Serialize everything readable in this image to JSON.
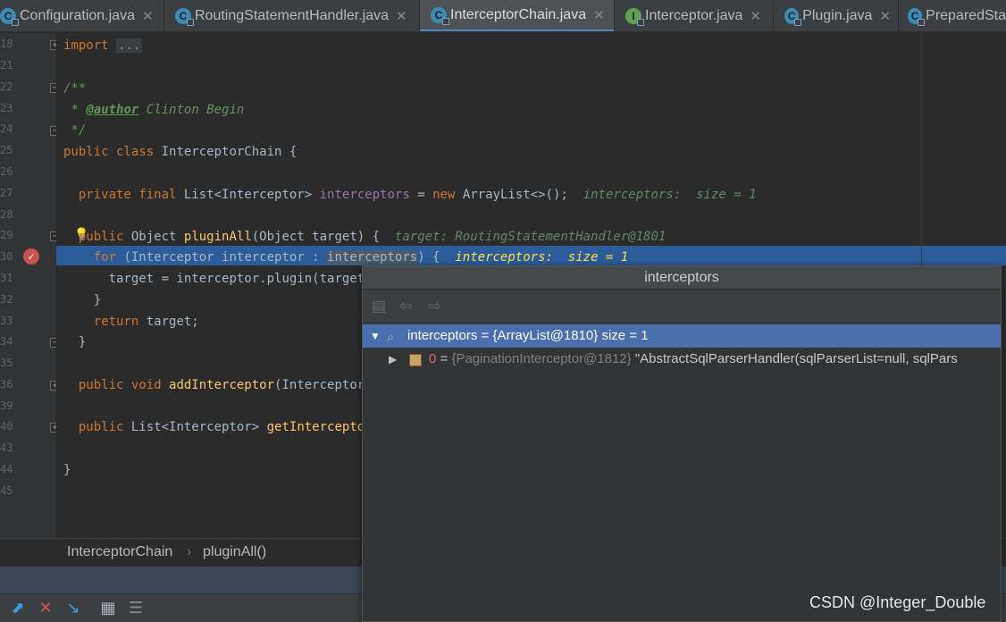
{
  "tabs": [
    {
      "label": "Configuration.java",
      "kind": "class",
      "active": false
    },
    {
      "label": "RoutingStatementHandler.java",
      "kind": "class",
      "active": false
    },
    {
      "label": "InterceptorChain.java",
      "kind": "class",
      "active": true
    },
    {
      "label": "Interceptor.java",
      "kind": "interface",
      "active": false
    },
    {
      "label": "Plugin.java",
      "kind": "class",
      "active": false
    },
    {
      "label": "PreparedSta",
      "kind": "class",
      "active": false
    }
  ],
  "gutter": {
    "line_numbers": [
      "18",
      "21",
      "22",
      "23",
      "24",
      "25",
      "26",
      "27",
      "28",
      "29",
      "30",
      "31",
      "32",
      "33",
      "34",
      "35",
      "36",
      "39",
      "40",
      "43",
      "44",
      "45"
    ],
    "breakpoint_icon": "breakpoint-check-icon"
  },
  "code": {
    "import_kw": "import",
    "import_dots": "...",
    "doc_open": "/**",
    "doc_star": "*",
    "author_tag": "@author",
    "author_name": "Clinton Begin",
    "doc_close": "*/",
    "class_decl_kw": "public class",
    "class_name": "InterceptorChain {",
    "field_mods": "private final",
    "field_type": "List<Interceptor>",
    "field_name": "interceptors",
    "field_eq": "=",
    "new_kw": "new",
    "field_init": "ArrayList<>();",
    "field_hint": "interceptors:  size = 1",
    "method_kw": "public",
    "method_ret": "Object",
    "method_name": "pluginAll",
    "method_params": "(Object target) {",
    "method_hint": "target: RoutingStatementHandler@1801",
    "for_kw": "for",
    "for_head": "(Interceptor interceptor :",
    "for_target": "interceptors",
    "for_close": ") {",
    "for_hint": "interceptors:  size = 1",
    "loop_body": "target = interceptor.plugin(target);",
    "close_brace": "}",
    "return_kw": "return",
    "return_val": "target;",
    "add_mods": "public void",
    "add_name": "addInterceptor",
    "add_params": "(Interceptor i",
    "get_mods": "public",
    "get_type": "List<Interceptor>",
    "get_name": "getInterceptors"
  },
  "breadcrumb": {
    "class": "InterceptorChain",
    "separator": "›",
    "method": "pluginAll()"
  },
  "popup": {
    "title": "interceptors",
    "tool_icons": [
      "folder-icon",
      "back-arrow-icon",
      "forward-arrow-icon"
    ],
    "rows": [
      {
        "expanded": true,
        "icon": "watch-variable-icon",
        "name": "interceptors",
        "eq": "=",
        "type": "{ArrayList@1810}",
        "extra": "size = 1"
      },
      {
        "expanded": false,
        "icon": "array-element-icon",
        "name": "0",
        "eq": "=",
        "type": "{PaginationInterceptor@1812}",
        "extra": "\"AbstractSqlParserHandler(sqlParserList=null, sqlPars"
      }
    ]
  },
  "toolbar": {
    "icons": [
      "step-over-icon",
      "remove-breakpoints-icon",
      "step-into-icon",
      "evaluate-icon",
      "threads-icon"
    ]
  },
  "watermark": "CSDN @Integer_Double",
  "colors": {
    "accent": "#4a88c7",
    "selection": "#2d5c9a",
    "tree_selection": "#4b6eaf",
    "breakpoint": "#c75450",
    "keyword": "#cc7832"
  }
}
